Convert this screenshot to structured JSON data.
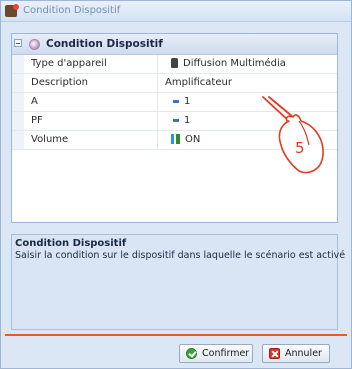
{
  "window": {
    "title": "Condition Dispositif"
  },
  "grid": {
    "group_label": "Condition Dispositif",
    "rows": [
      {
        "name": "Type d'appareil",
        "value": "Diffusion Multimédia",
        "icon": "speaker-icon"
      },
      {
        "name": "Description",
        "value": "Amplificateur",
        "icon": ""
      },
      {
        "name": "A",
        "value": "1",
        "icon": "value-marker-icon"
      },
      {
        "name": "PF",
        "value": "1",
        "icon": "value-marker-icon"
      },
      {
        "name": "Volume",
        "value": "ON",
        "icon": "volume-icon"
      }
    ]
  },
  "annotation": {
    "step_number": "5"
  },
  "description": {
    "title": "Condition Dispositif",
    "text": "Saisir la condition sur le dispositif dans laquelle le scénario est activé"
  },
  "buttons": {
    "confirm": "Confirmer",
    "cancel": "Annuler"
  },
  "colors": {
    "accent_line": "#e75b2a",
    "panel_bg": "#dbe7f5"
  }
}
